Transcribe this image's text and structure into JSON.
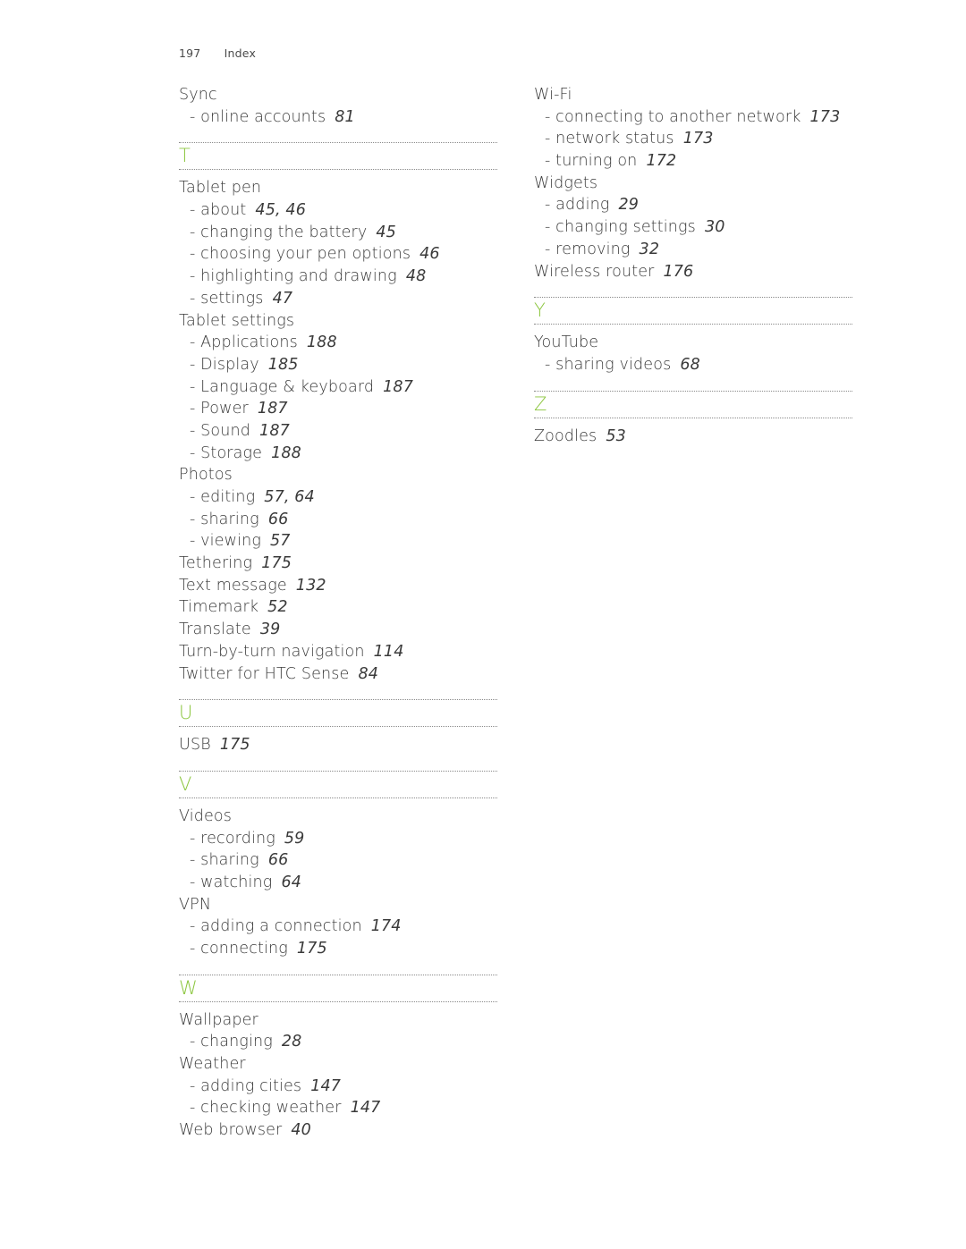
{
  "header": {
    "page_number": "197",
    "section_title": "Index"
  },
  "colors": {
    "accent_letter": "#8cc63f",
    "text": "#3a3a3a"
  },
  "left_column": {
    "sync": [
      {
        "term": "Sync",
        "pages": "",
        "sub": false
      },
      {
        "term": "- online accounts",
        "pages": "81",
        "sub": true
      }
    ],
    "T": {
      "letter": "T",
      "entries": [
        {
          "term": "Tablet pen",
          "pages": "",
          "sub": false
        },
        {
          "term": "- about",
          "pages": "45, 46",
          "sub": true
        },
        {
          "term": "- changing the battery",
          "pages": "45",
          "sub": true
        },
        {
          "term": "- choosing your pen options",
          "pages": "46",
          "sub": true
        },
        {
          "term": "- highlighting and drawing",
          "pages": "48",
          "sub": true
        },
        {
          "term": "- settings",
          "pages": "47",
          "sub": true
        },
        {
          "term": "Tablet settings",
          "pages": "",
          "sub": false
        },
        {
          "term": "- Applications",
          "pages": "188",
          "sub": true
        },
        {
          "term": "- Display",
          "pages": "185",
          "sub": true
        },
        {
          "term": "- Language & keyboard",
          "pages": "187",
          "sub": true
        },
        {
          "term": "- Power",
          "pages": "187",
          "sub": true
        },
        {
          "term": "- Sound",
          "pages": "187",
          "sub": true
        },
        {
          "term": "- Storage",
          "pages": "188",
          "sub": true
        },
        {
          "term": "Photos",
          "pages": "",
          "sub": false
        },
        {
          "term": "- editing",
          "pages": "57, 64",
          "sub": true
        },
        {
          "term": "- sharing",
          "pages": "66",
          "sub": true
        },
        {
          "term": "- viewing",
          "pages": "57",
          "sub": true
        },
        {
          "term": "Tethering",
          "pages": "175",
          "sub": false
        },
        {
          "term": "Text message",
          "pages": "132",
          "sub": false
        },
        {
          "term": "Timemark",
          "pages": "52",
          "sub": false
        },
        {
          "term": "Translate",
          "pages": "39",
          "sub": false
        },
        {
          "term": "Turn-by-turn navigation",
          "pages": "114",
          "sub": false
        },
        {
          "term": "Twitter for HTC Sense",
          "pages": "84",
          "sub": false
        }
      ]
    },
    "U": {
      "letter": "U",
      "entries": [
        {
          "term": "USB",
          "pages": "175",
          "sub": false
        }
      ]
    },
    "V": {
      "letter": "V",
      "entries": [
        {
          "term": "Videos",
          "pages": "",
          "sub": false
        },
        {
          "term": "- recording",
          "pages": "59",
          "sub": true
        },
        {
          "term": "- sharing",
          "pages": "66",
          "sub": true
        },
        {
          "term": "- watching",
          "pages": "64",
          "sub": true
        },
        {
          "term": "VPN",
          "pages": "",
          "sub": false
        },
        {
          "term": "- adding a connection",
          "pages": "174",
          "sub": true
        },
        {
          "term": "- connecting",
          "pages": "175",
          "sub": true
        }
      ]
    },
    "W": {
      "letter": "W",
      "entries": [
        {
          "term": "Wallpaper",
          "pages": "",
          "sub": false
        },
        {
          "term": "- changing",
          "pages": "28",
          "sub": true
        },
        {
          "term": "Weather",
          "pages": "",
          "sub": false
        },
        {
          "term": "- adding cities",
          "pages": "147",
          "sub": true
        },
        {
          "term": "- checking weather",
          "pages": "147",
          "sub": true
        },
        {
          "term": "Web browser",
          "pages": "40",
          "sub": false
        }
      ]
    }
  },
  "right_column": {
    "W_cont": [
      {
        "term": "Wi-Fi",
        "pages": "",
        "sub": false
      },
      {
        "term": "- connecting to another network",
        "pages": "173",
        "sub": true
      },
      {
        "term": "- network status",
        "pages": "173",
        "sub": true
      },
      {
        "term": "- turning on",
        "pages": "172",
        "sub": true
      },
      {
        "term": "Widgets",
        "pages": "",
        "sub": false
      },
      {
        "term": "- adding",
        "pages": "29",
        "sub": true
      },
      {
        "term": "- changing settings",
        "pages": "30",
        "sub": true
      },
      {
        "term": "- removing",
        "pages": "32",
        "sub": true
      },
      {
        "term": "Wireless router",
        "pages": "176",
        "sub": false
      }
    ],
    "Y": {
      "letter": "Y",
      "entries": [
        {
          "term": "YouTube",
          "pages": "",
          "sub": false
        },
        {
          "term": "- sharing videos",
          "pages": "68",
          "sub": true
        }
      ]
    },
    "Z": {
      "letter": "Z",
      "entries": [
        {
          "term": "Zoodles",
          "pages": "53",
          "sub": false
        }
      ]
    }
  }
}
